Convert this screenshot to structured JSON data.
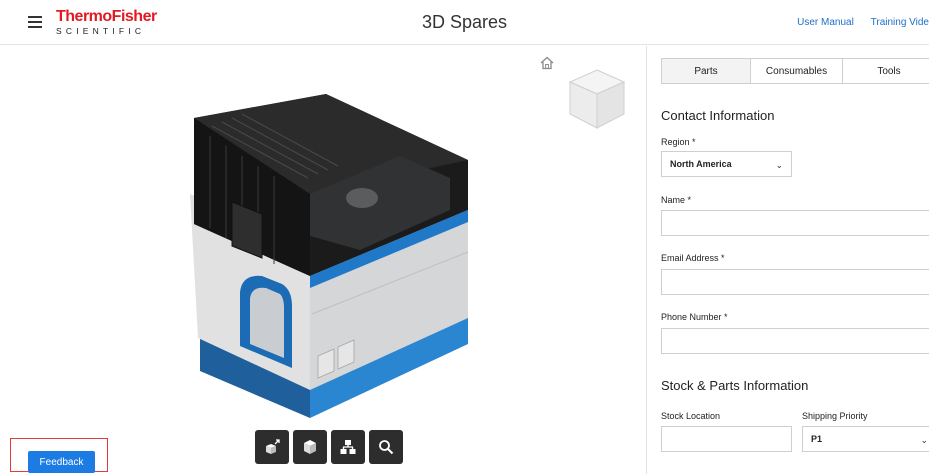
{
  "header": {
    "brand_main": "ThermoFisher",
    "brand_sub": "SCIENTIFIC",
    "title": "3D Spares",
    "links": [
      "User Manual",
      "Training Vide"
    ]
  },
  "viewer": {
    "toolbar_icons": [
      "explode-icon",
      "isolate-icon",
      "structure-tree-icon",
      "magnify-icon"
    ],
    "feedback_label": "Feedback"
  },
  "tabs": {
    "parts": "Parts",
    "consumables": "Consumables",
    "tools": "Tools",
    "active": "Parts"
  },
  "contact": {
    "heading": "Contact Information",
    "region_label": "Region *",
    "region_value": "North America",
    "name_label": "Name *",
    "name_value": "",
    "email_label": "Email Address *",
    "email_value": "",
    "phone_label": "Phone Number *",
    "phone_value": ""
  },
  "stock": {
    "heading": "Stock & Parts Information",
    "location_label": "Stock Location",
    "location_value": "",
    "priority_label": "Shipping Priority",
    "priority_value": "P1"
  },
  "colors": {
    "brand_red": "#e31a22",
    "link_blue": "#1d70c8",
    "feedback_blue": "#1c7ce3",
    "highlight_red": "#e23b3b"
  }
}
